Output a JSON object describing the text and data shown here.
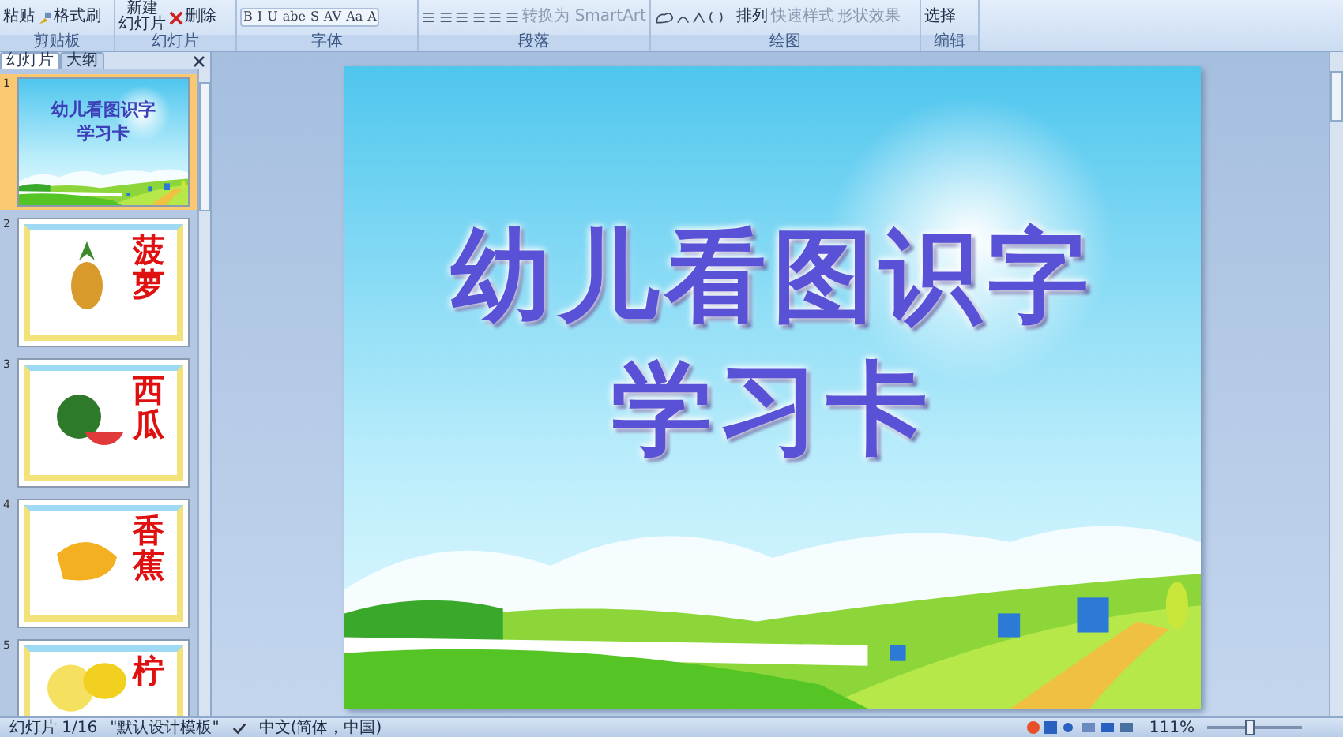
{
  "ribbon": {
    "groups": [
      {
        "label": "剪贴板",
        "kind": "clipboard",
        "buttons": [
          {
            "label": "粘贴",
            "disabled": false
          },
          {
            "label": "格式刷",
            "disabled": false
          }
        ]
      },
      {
        "label": "幻灯片",
        "kind": "slides",
        "buttons": [
          {
            "lines": [
              "新建",
              "幻灯片"
            ],
            "disabled": false
          },
          {
            "label": "删除",
            "disabled": false
          }
        ]
      },
      {
        "label": "字体",
        "kind": "font",
        "buttons": [
          {
            "label": "B",
            "disabled": false
          },
          {
            "label": "I",
            "disabled": false
          },
          {
            "label": "U",
            "disabled": false
          },
          {
            "label": "abe",
            "disabled": false
          },
          {
            "label": "S",
            "disabled": false
          },
          {
            "label": "AV",
            "disabled": false
          },
          {
            "label": "Aa",
            "disabled": false
          },
          {
            "label": "A",
            "disabled": false
          }
        ]
      },
      {
        "label": "段落",
        "kind": "paragraph",
        "buttons": [
          {
            "label": "转换为 SmartArt",
            "disabled": true
          }
        ]
      },
      {
        "label": "绘图",
        "kind": "drawing",
        "buttons": [
          {
            "label": "排列",
            "disabled": false
          },
          {
            "label": "快速样式",
            "disabled": true
          },
          {
            "label": "形状效果",
            "disabled": true
          }
        ]
      },
      {
        "label": "编辑",
        "kind": "editing",
        "buttons": [
          {
            "label": "选择",
            "disabled": false
          }
        ]
      }
    ]
  },
  "panel": {
    "tabs": [
      {
        "label": "幻灯片",
        "selected": true
      },
      {
        "label": "大纲",
        "selected": false
      }
    ],
    "slides": [
      {
        "number": "1",
        "kind": "title",
        "selected": true,
        "lines": [
          "幼儿看图识字",
          "学习卡"
        ]
      },
      {
        "number": "2",
        "kind": "card",
        "selected": false,
        "lines": [
          "菠萝"
        ]
      },
      {
        "number": "3",
        "kind": "card",
        "selected": false,
        "lines": [
          "西瓜"
        ]
      },
      {
        "number": "4",
        "kind": "card",
        "selected": false,
        "lines": [
          "香蕉"
        ]
      },
      {
        "number": "5",
        "kind": "card",
        "selected": false,
        "lines": [
          "柠"
        ]
      }
    ]
  },
  "slide": {
    "lines": [
      "幼儿看图识字",
      "学习卡"
    ]
  },
  "status_bar": {
    "slide": "幻灯片 1/16",
    "template": "\"默认设计模板\"",
    "language": "中文(简体，中国)",
    "zoom": "111%",
    "zoom_level": {
      "level": 0.45
    }
  }
}
